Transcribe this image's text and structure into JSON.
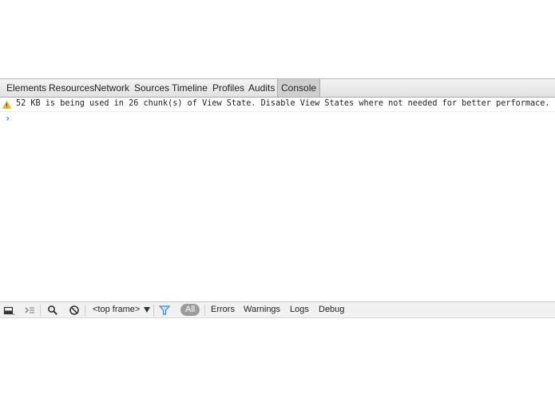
{
  "tabs": [
    {
      "label": "Elements"
    },
    {
      "label": "Resources"
    },
    {
      "label": "Network"
    },
    {
      "label": "Sources"
    },
    {
      "label": "Timeline"
    },
    {
      "label": "Profiles"
    },
    {
      "label": "Audits"
    },
    {
      "label": "Console",
      "selected": true
    }
  ],
  "console": {
    "warning_message": "52 KB is being used in 26 chunk(s) of View State. Disable View States where not needed for better performace.",
    "prompt_symbol": "›"
  },
  "statusbar": {
    "frame_label": "<top frame>",
    "filters": [
      "All",
      "Errors",
      "Warnings",
      "Logs",
      "Debug"
    ]
  },
  "colors": {
    "warning": "#f2c200",
    "prompt": "#2a7bd6",
    "filter_icon": "#3b87d8",
    "active_filter_bg": "#9c9c9c"
  },
  "icons": [
    "dock-icon",
    "drawer-toggle-icon",
    "search-icon",
    "clear-console-icon",
    "filter-icon",
    "warning-icon"
  ]
}
